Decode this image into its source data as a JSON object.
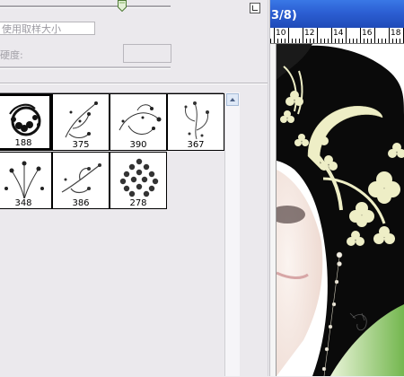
{
  "brush_panel": {
    "use_sample_size_label": "使用取样大小",
    "hardness_label": "硬度:",
    "brushes": [
      {
        "size": "188",
        "selected": true
      },
      {
        "size": "375",
        "selected": false
      },
      {
        "size": "390",
        "selected": false
      },
      {
        "size": "367",
        "selected": false
      },
      {
        "size": "348",
        "selected": false
      },
      {
        "size": "386",
        "selected": false
      },
      {
        "size": "278",
        "selected": false
      }
    ]
  },
  "document": {
    "title_fragment": "3/8)",
    "ruler_marks": [
      "10",
      "12",
      "14",
      "16",
      "18"
    ]
  }
}
